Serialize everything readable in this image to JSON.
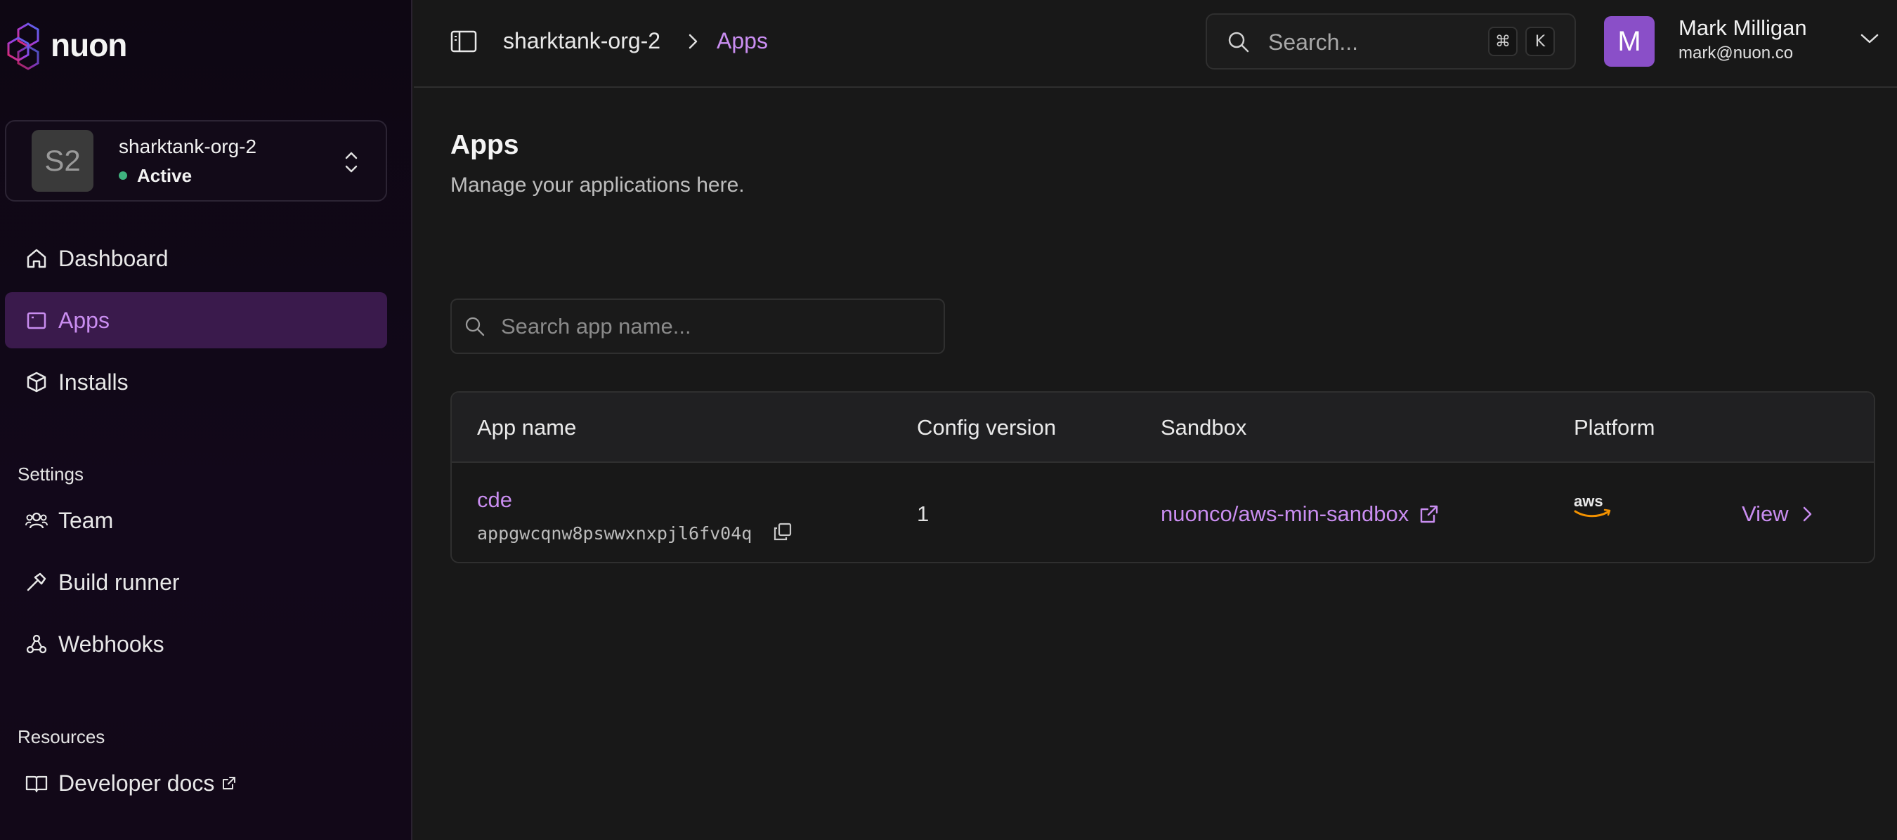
{
  "brand": {
    "name": "nuon"
  },
  "org": {
    "initials": "S2",
    "name": "sharktank-org-2",
    "status": "Active"
  },
  "nav": {
    "dashboard": "Dashboard",
    "apps": "Apps",
    "installs": "Installs",
    "settings_label": "Settings",
    "team": "Team",
    "build_runner": "Build runner",
    "webhooks": "Webhooks",
    "resources_label": "Resources",
    "developer_docs": "Developer docs"
  },
  "breadcrumb": {
    "org": "sharktank-org-2",
    "current": "Apps"
  },
  "global_search": {
    "placeholder": "Search...",
    "kbd_mod": "⌘",
    "kbd_key": "K"
  },
  "user": {
    "initial": "M",
    "name": "Mark Milligan",
    "email": "mark@nuon.co"
  },
  "page": {
    "title": "Apps",
    "subtitle": "Manage your applications here."
  },
  "app_search": {
    "placeholder": "Search app name..."
  },
  "table": {
    "headers": [
      "App name",
      "Config version",
      "Sandbox",
      "Platform"
    ],
    "rows": [
      {
        "name": "cde",
        "id": "appgwcqnw8pswwxnxpjl6fv04q",
        "config_version": "1",
        "sandbox": "nuonco/aws-min-sandbox",
        "platform": "aws",
        "action": "View"
      }
    ]
  },
  "colors": {
    "accent": "#c98df0",
    "active_bg": "#3a1a4c",
    "status_green": "#3fb27f",
    "aws_orange": "#f29100"
  }
}
